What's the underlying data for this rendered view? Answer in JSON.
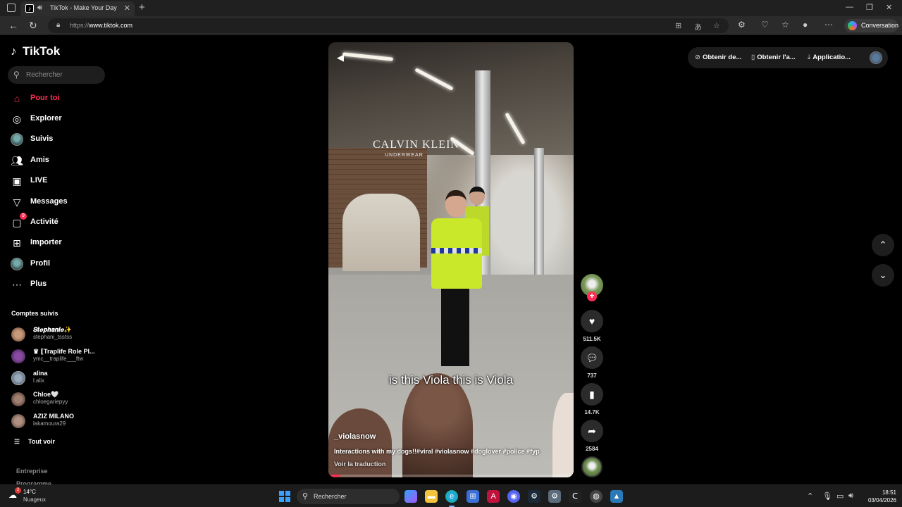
{
  "browser": {
    "tab_title": "TikTok - Make Your Day",
    "url_prefix": "https://",
    "url_host": "www.tiktok.com",
    "conversation_label": "Conversation"
  },
  "sidebar": {
    "logo": "TikTok",
    "search_placeholder": "Rechercher",
    "items": [
      {
        "label": "Pour toi",
        "icon": "home-icon",
        "active": true
      },
      {
        "label": "Explorer",
        "icon": "compass-icon"
      },
      {
        "label": "Suivis",
        "icon": "avatar-icon"
      },
      {
        "label": "Amis",
        "icon": "friends-icon"
      },
      {
        "label": "LIVE",
        "icon": "live-icon"
      },
      {
        "label": "Messages",
        "icon": "messages-icon"
      },
      {
        "label": "Activité",
        "icon": "activity-icon",
        "badge": "9"
      },
      {
        "label": "Importer",
        "icon": "upload-icon"
      },
      {
        "label": "Profil",
        "icon": "profile-icon"
      },
      {
        "label": "Plus",
        "icon": "more-icon"
      }
    ],
    "followed_title": "Comptes suivis",
    "followed": [
      {
        "name": "𝑺𝒕𝒆𝒑𝒉𝒂𝒏𝒊𝒆✨",
        "user": "stephani_tsstss"
      },
      {
        "name": "♛ ⟦Traplife Role Pl...",
        "user": "ymc__traplife___ftw"
      },
      {
        "name": "alina",
        "user": "l.alix"
      },
      {
        "name": "Chloe🤍",
        "user": "chloegariepyy"
      },
      {
        "name": "AZIZ MILANO",
        "user": "lakamoura29"
      }
    ],
    "see_all": "Tout voir",
    "footer": [
      "Entreprise",
      "Programme"
    ]
  },
  "video": {
    "sign_brand": "CALVIN KLEIN",
    "sign_sub": "UNDERWEAR",
    "caption": "is this Viola this is Viola",
    "author": "_violasnow",
    "description": "Interactions with my dogs!!#viral #violasnow #doglover #police #fyp",
    "translate": "Voir la traduction",
    "progress": 0.05
  },
  "actions": {
    "likes": "511.5K",
    "comments": "737",
    "saves": "14.7K",
    "shares": "2584"
  },
  "top_links": [
    {
      "label": "Obtenir de...",
      "icon": "coin-icon"
    },
    {
      "label": "Obtenir l'a...",
      "icon": "phone-icon"
    },
    {
      "label": "Applicatio...",
      "icon": "download-icon"
    }
  ],
  "taskbar": {
    "temp": "14°C",
    "weather": "Nuageux",
    "weather_badge": "2",
    "search": "Rechercher",
    "time": "18:51",
    "date": "03/04/2026"
  }
}
